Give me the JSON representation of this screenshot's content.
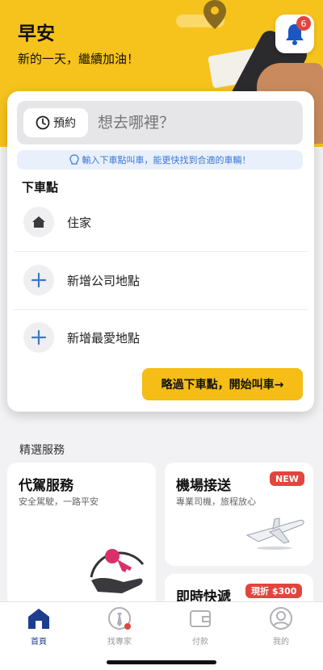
{
  "header": {
    "greeting": "早安",
    "subtitle": "新的一天，繼續加油！",
    "notification_count": "6"
  },
  "search": {
    "reserve_label": "預約",
    "placeholder": "想去哪裡？",
    "hint": "輸入下車點叫車，能更快找到合適的車輛！"
  },
  "destinations": {
    "section_label": "下車點",
    "items": [
      {
        "label": "住家",
        "icon": "home-icon"
      },
      {
        "label": "新增公司地點",
        "icon": "plus-icon"
      },
      {
        "label": "新增最愛地點",
        "icon": "plus-icon"
      }
    ]
  },
  "skip_button": "略過下車點，開始叫車→",
  "featured": {
    "title": "精選服務",
    "cards": [
      {
        "title": "代駕服務",
        "subtitle": "安全駕駛，一路平安"
      },
      {
        "title": "機場接送",
        "subtitle": "專業司機，旅程放心",
        "badge": "NEW"
      },
      {
        "title": "即時快遞",
        "badge": "現折 $300"
      }
    ]
  },
  "nav": [
    {
      "label": "首頁",
      "icon": "home-icon",
      "active": true
    },
    {
      "label": "找專家",
      "icon": "expert-icon"
    },
    {
      "label": "付款",
      "icon": "wallet-icon"
    },
    {
      "label": "我的",
      "icon": "profile-icon"
    }
  ],
  "colors": {
    "brand_yellow": "#f6c31d",
    "accent_blue": "#3a78d2",
    "nav_active": "#1d3e8f",
    "badge_red": "#e0463f"
  }
}
